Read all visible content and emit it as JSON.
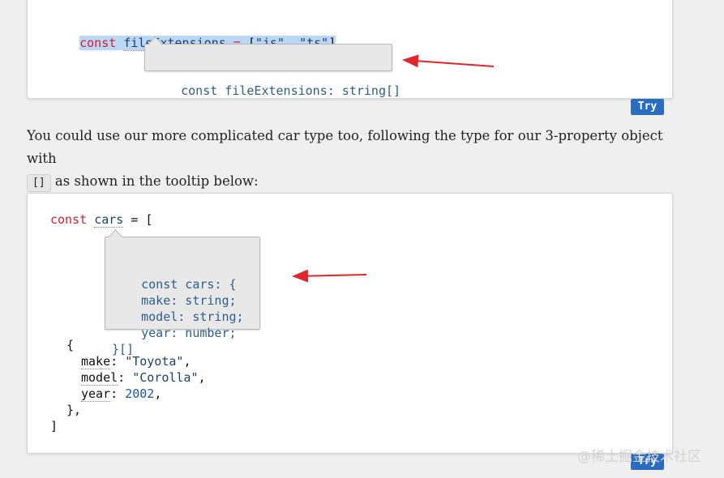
{
  "example1": {
    "code": {
      "kw": "const",
      "name": "fileExtensions",
      "eq": " = ",
      "open": "[",
      "s1": "\"js\"",
      "comma": ", ",
      "s2": "\"ts\"",
      "close": "]"
    },
    "tooltip": "const fileExtensions: string[]",
    "try_label": "Try"
  },
  "paragraph": {
    "part1": "You could use our more complicated car type too, following the type for our 3-property object with",
    "inline_code": "[]",
    "part2": "as shown in the tooltip below:"
  },
  "example2": {
    "line1": {
      "kw": "const",
      "name": "cars",
      "rest": " = ["
    },
    "tooltip": "const cars: {\n    make: string;\n    model: string;\n    year: number;\n}[]",
    "obj_open": "{",
    "make_key": "make",
    "make_val": "\"Toyota\"",
    "model_key": "model",
    "model_val": "\"Corolla\"",
    "year_key": "year",
    "year_val": "2002",
    "obj_close": "},",
    "arr_close": "]",
    "try_label": "Try"
  },
  "watermark": "@稀土掘金技术社区",
  "colors": {
    "keyword": "#cf222e",
    "identifier": "#1f3f6e",
    "number": "#1a55b5",
    "tooltip_text": "#2d5d8c",
    "try_button": "#2a6cc0",
    "arrow": "#e0262b"
  }
}
